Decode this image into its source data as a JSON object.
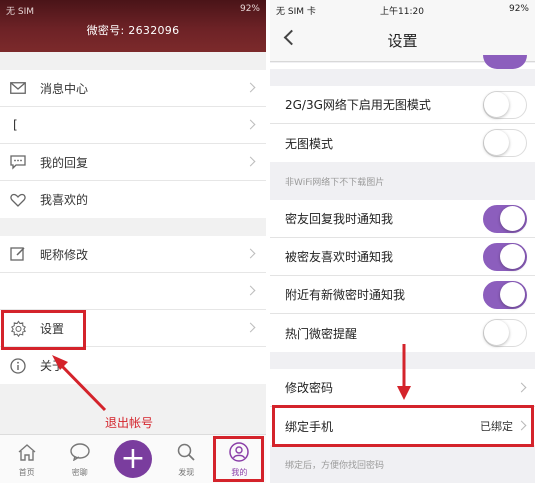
{
  "left": {
    "status": {
      "carrier": "无 SIM",
      "battery": "92%"
    },
    "header": {
      "id_label": "微密号:",
      "id_value": "2632096"
    },
    "menu_group1": [
      {
        "label": "消息中心",
        "icon": "envelope-icon"
      },
      {
        "label": "[",
        "icon": ""
      },
      {
        "label": "我的回复",
        "icon": "chat-bubble-icon"
      },
      {
        "label": "我喜欢的",
        "icon": "heart-icon"
      }
    ],
    "menu_group2": [
      {
        "label": "昵称修改",
        "icon": "edit-icon"
      },
      {
        "label": "",
        "icon": ""
      },
      {
        "label": "设置",
        "icon": "gear-icon"
      },
      {
        "label": "关于",
        "icon": "info-icon"
      }
    ],
    "annotation": {
      "text": "退出帐号",
      "color": "#d4232b"
    },
    "tabs": [
      {
        "label": "首页",
        "icon": "home-icon"
      },
      {
        "label": "密聊",
        "icon": "chat-icon"
      },
      {
        "label": "",
        "icon": "plus-icon"
      },
      {
        "label": "发现",
        "icon": "search-icon"
      },
      {
        "label": "我的",
        "icon": "user-icon"
      }
    ]
  },
  "right": {
    "status": {
      "carrier": "无 SIM 卡",
      "time": "上午11:20",
      "battery": "92%"
    },
    "nav": {
      "title": "设置"
    },
    "group1": [
      {
        "label": "2G/3G网络下启用无图模式",
        "toggle": false
      },
      {
        "label": "无图模式",
        "toggle": false
      }
    ],
    "note1": "非WiFi网络下不下载图片",
    "group2": [
      {
        "label": "密友回复我时通知我",
        "toggle": true
      },
      {
        "label": "被密友喜欢时通知我",
        "toggle": true
      },
      {
        "label": "附近有新微密时通知我",
        "toggle": true
      },
      {
        "label": "热门微密提醒",
        "toggle": false
      }
    ],
    "group3": [
      {
        "label": "修改密码",
        "value": ""
      },
      {
        "label": "绑定手机",
        "value": "已绑定"
      }
    ],
    "note2": "绑定后，方便你找回密码"
  },
  "colors": {
    "accent": "#8c5ebd",
    "annotation": "#d4232b",
    "header": "#6d2226"
  }
}
